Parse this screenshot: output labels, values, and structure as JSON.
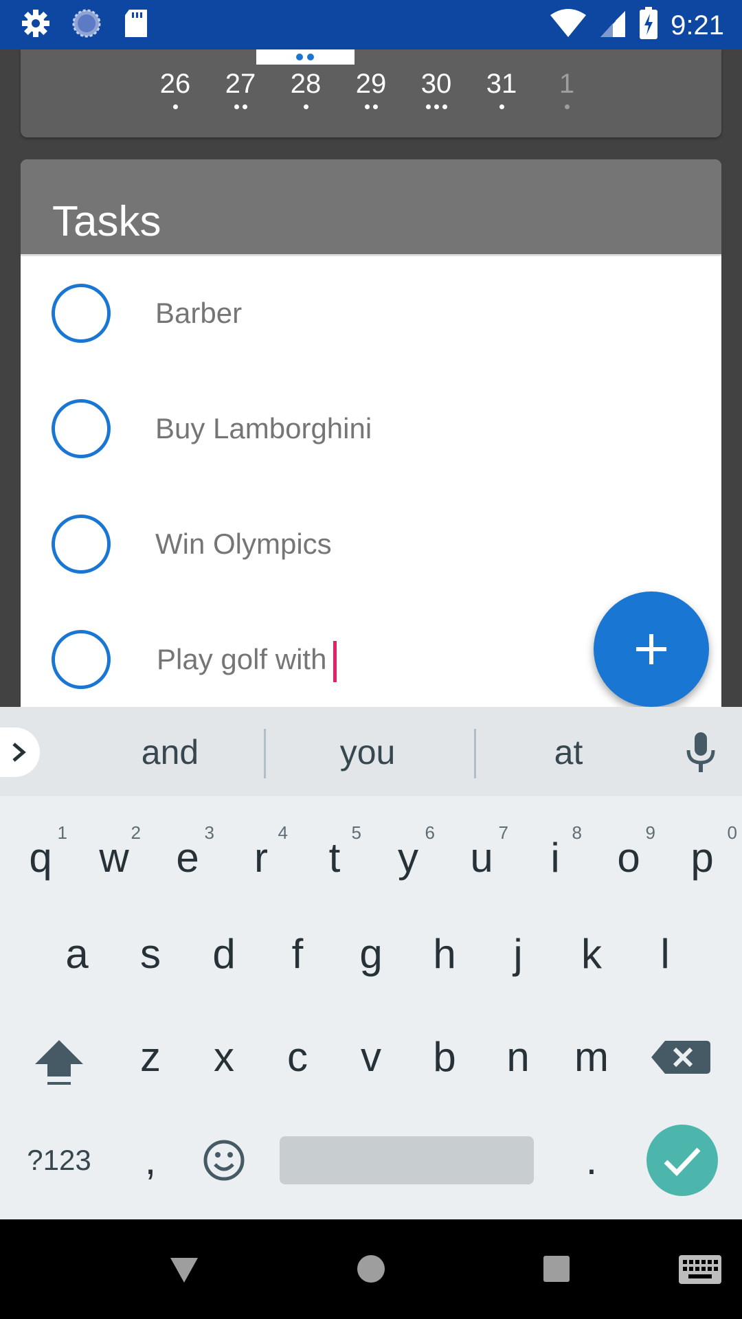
{
  "status_bar": {
    "time": "9:21",
    "icons": [
      "settings-gear-icon",
      "sync-circle-icon",
      "sd-card-icon",
      "wifi-icon",
      "cell-signal-icon",
      "battery-charging-icon"
    ]
  },
  "calendar": {
    "days": [
      {
        "label": "26",
        "dots": 1,
        "dim": false
      },
      {
        "label": "27",
        "dots": 2,
        "dim": false
      },
      {
        "label": "28",
        "dots": 1,
        "dim": false,
        "selected": true
      },
      {
        "label": "29",
        "dots": 2,
        "dim": false
      },
      {
        "label": "30",
        "dots": 3,
        "dim": false
      },
      {
        "label": "31",
        "dots": 1,
        "dim": false
      },
      {
        "label": "1",
        "dots": 1,
        "dim": true
      }
    ]
  },
  "tasks": {
    "title": "Tasks",
    "items": [
      {
        "label": "Barber"
      },
      {
        "label": "Buy Lamborghini"
      },
      {
        "label": "Win Olympics"
      },
      {
        "label": "Play golf with"
      }
    ]
  },
  "keyboard": {
    "suggestions": [
      "and",
      "you",
      "at"
    ],
    "row1": [
      {
        "key": "q",
        "hint": "1"
      },
      {
        "key": "w",
        "hint": "2"
      },
      {
        "key": "e",
        "hint": "3"
      },
      {
        "key": "r",
        "hint": "4"
      },
      {
        "key": "t",
        "hint": "5"
      },
      {
        "key": "y",
        "hint": "6"
      },
      {
        "key": "u",
        "hint": "7"
      },
      {
        "key": "i",
        "hint": "8"
      },
      {
        "key": "o",
        "hint": "9"
      },
      {
        "key": "p",
        "hint": "0"
      }
    ],
    "row2": [
      "a",
      "s",
      "d",
      "f",
      "g",
      "h",
      "j",
      "k",
      "l"
    ],
    "row3": [
      "z",
      "x",
      "c",
      "v",
      "b",
      "n",
      "m"
    ],
    "symbols_label": "?123",
    "comma": ",",
    "period": "."
  },
  "colors": {
    "status_bar": "#0d47a1",
    "accent": "#1976d2",
    "caret": "#e91e63",
    "enter": "#4db6ac"
  }
}
